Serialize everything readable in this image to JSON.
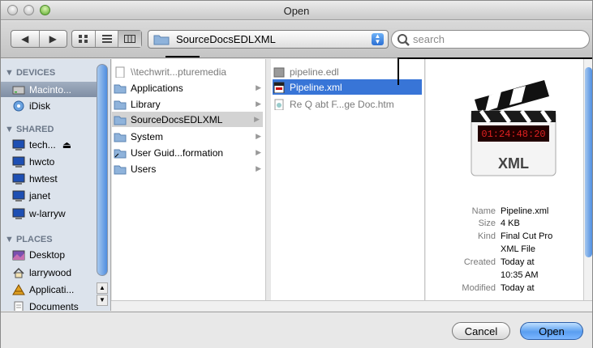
{
  "window": {
    "title": "Open"
  },
  "toolbar": {
    "path_popup": "SourceDocsEDLXML",
    "search_placeholder": "search"
  },
  "sidebar": {
    "sections": [
      {
        "label": "▼ DEVICES"
      },
      {
        "label": "▼ SHARED"
      },
      {
        "label": "▼ PLACES"
      }
    ],
    "items": [
      {
        "label": "Macinto...",
        "icon": "hard-drive-icon"
      },
      {
        "label": "iDisk",
        "icon": "idisk-icon"
      },
      {
        "label": "tech...",
        "icon": "network-computer-icon"
      },
      {
        "label": "hwcto",
        "icon": "network-computer-icon"
      },
      {
        "label": "hwtest",
        "icon": "network-computer-icon"
      },
      {
        "label": "janet",
        "icon": "network-computer-icon"
      },
      {
        "label": "w-larryw",
        "icon": "network-computer-icon"
      },
      {
        "label": "Desktop",
        "icon": "desktop-icon"
      },
      {
        "label": "larrywood",
        "icon": "home-icon"
      },
      {
        "label": "Applicati...",
        "icon": "applications-icon"
      },
      {
        "label": "Documents",
        "icon": "documents-icon"
      }
    ]
  },
  "column1": {
    "items": [
      {
        "label": "\\\\techwrit...pturemedia"
      },
      {
        "label": "Applications"
      },
      {
        "label": "Library"
      },
      {
        "label": "SourceDocsEDLXML"
      },
      {
        "label": "System"
      },
      {
        "label": "User Guid...formation"
      },
      {
        "label": "Users"
      }
    ]
  },
  "column2": {
    "items": [
      {
        "label": "pipeline.edl"
      },
      {
        "label": "Pipeline.xml"
      },
      {
        "label": "Re Q abt F...ge Doc.htm"
      }
    ]
  },
  "preview": {
    "timecode": "01:24:48:20",
    "badge": "XML",
    "meta": [
      {
        "key": "Name",
        "value": "Pipeline.xml"
      },
      {
        "key": "Size",
        "value": "4 KB"
      },
      {
        "key": "Kind",
        "value": "Final Cut Pro"
      },
      {
        "key": "",
        "value": "XML File"
      },
      {
        "key": "Created",
        "value": "Today at"
      },
      {
        "key": "",
        "value": "10:35 AM"
      },
      {
        "key": "Modified",
        "value": "Today at"
      }
    ]
  },
  "footer": {
    "cancel": "Cancel",
    "open": "Open"
  },
  "colors": {
    "selection": "#3875d7",
    "accent": "#5a9ef0"
  }
}
